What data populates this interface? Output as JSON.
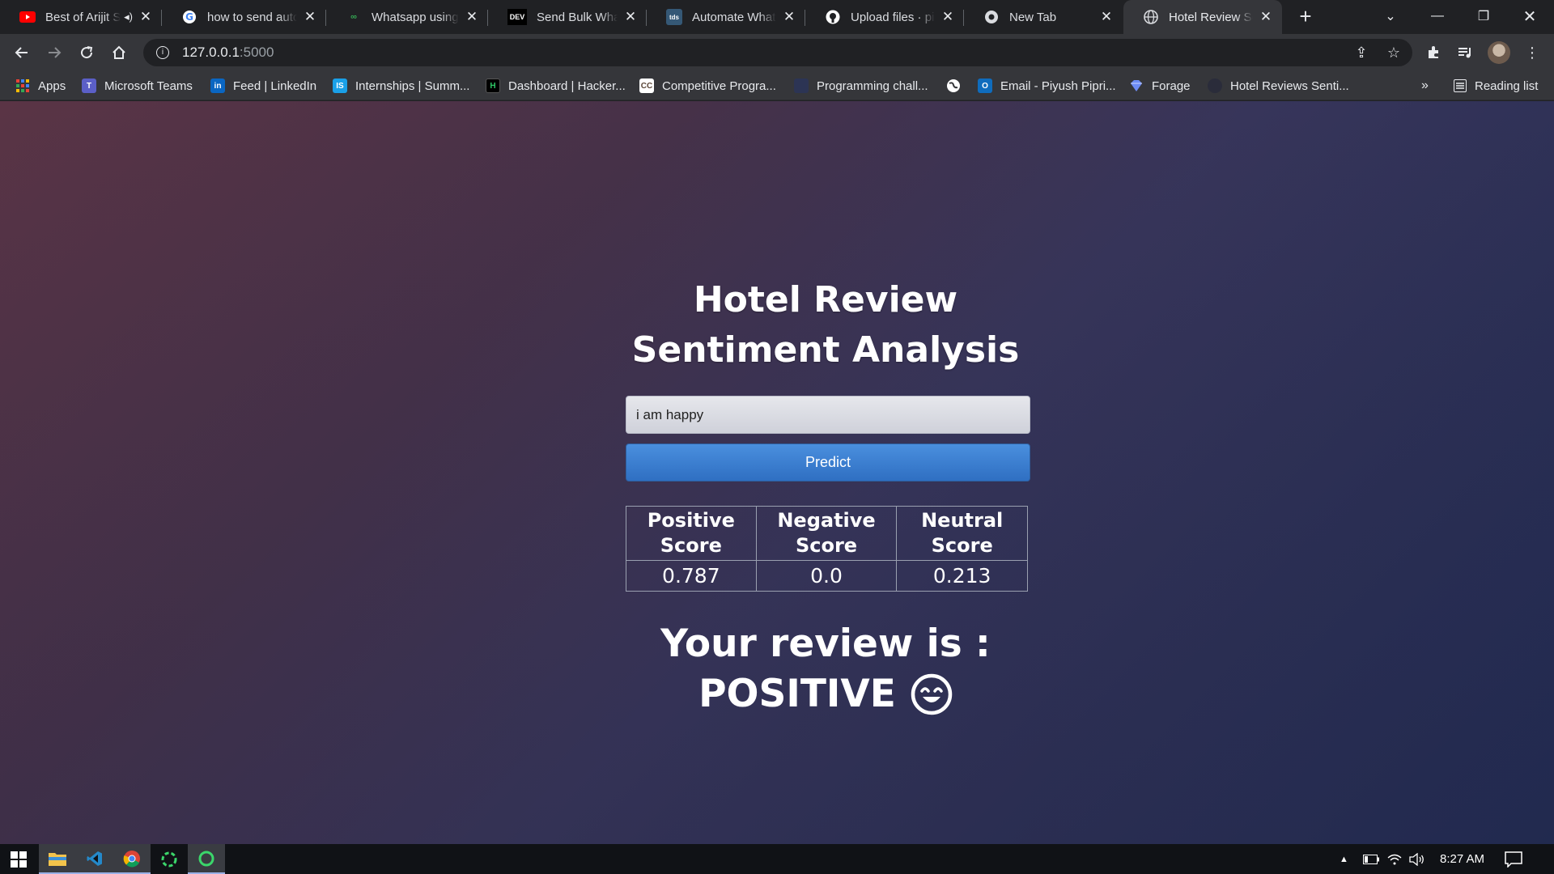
{
  "browser": {
    "tabs": [
      {
        "title": "Best of Arijit Singh",
        "favicon": "youtube-icon",
        "audio": true
      },
      {
        "title": "how to send automated",
        "favicon": "google-icon"
      },
      {
        "title": "Whatsapp using Python",
        "favicon": "whatsapp-icon"
      },
      {
        "title": "Send Bulk WhatsApp",
        "favicon": "dev-icon"
      },
      {
        "title": "Automate WhatsApp",
        "favicon": "tds-icon"
      },
      {
        "title": "Upload files · piyush",
        "favicon": "github-icon"
      },
      {
        "title": "New Tab",
        "favicon": "chrome-icon"
      },
      {
        "title": "Hotel Review Sentiment",
        "favicon": "globe-icon",
        "active": true
      }
    ],
    "address": {
      "host": "127.0.0.1",
      "port": ":5000"
    },
    "bookmarks": [
      {
        "label": "Apps",
        "icon": "apps-grid-icon"
      },
      {
        "label": "Microsoft Teams",
        "icon": "teams-icon"
      },
      {
        "label": "Feed | LinkedIn",
        "icon": "linkedin-icon"
      },
      {
        "label": "Internships | Summ...",
        "icon": "internshala-icon"
      },
      {
        "label": "Dashboard | Hacker...",
        "icon": "hackerrank-icon"
      },
      {
        "label": "Competitive Progra...",
        "icon": "codechef-icon"
      },
      {
        "label": "Programming chall...",
        "icon": "hackerearth-icon"
      },
      {
        "label": "",
        "icon": "globe-icon"
      },
      {
        "label": "Email - Piyush Pipri...",
        "icon": "outlook-icon"
      },
      {
        "label": "Forage",
        "icon": "forage-icon"
      },
      {
        "label": "Hotel Reviews Senti...",
        "icon": "globe-icon"
      }
    ],
    "reading_list": "Reading list"
  },
  "app": {
    "title_line1": "Hotel Review",
    "title_line2": "Sentiment Analysis",
    "review_input": {
      "value": "i am happy",
      "placeholder": ""
    },
    "predict_label": "Predict",
    "scores": {
      "headers": [
        "Positive Score",
        "Negative Score",
        "Neutral Score"
      ],
      "values": [
        "0.787",
        "0.0",
        "0.213"
      ]
    },
    "result_prefix": "Your review is :",
    "result_label": "POSITIVE",
    "result_icon": "smiley-icon"
  },
  "taskbar": {
    "clock": "8:27 AM",
    "apps": [
      "windows-start-icon",
      "file-explorer-icon",
      "vscode-icon",
      "chrome-icon",
      "spinner-app-icon",
      "spinner-app-icon"
    ]
  },
  "colors": {
    "accent_button": "#3a7fd5",
    "page_gradient_start": "#5a3445",
    "page_gradient_end": "#1f2a52"
  }
}
